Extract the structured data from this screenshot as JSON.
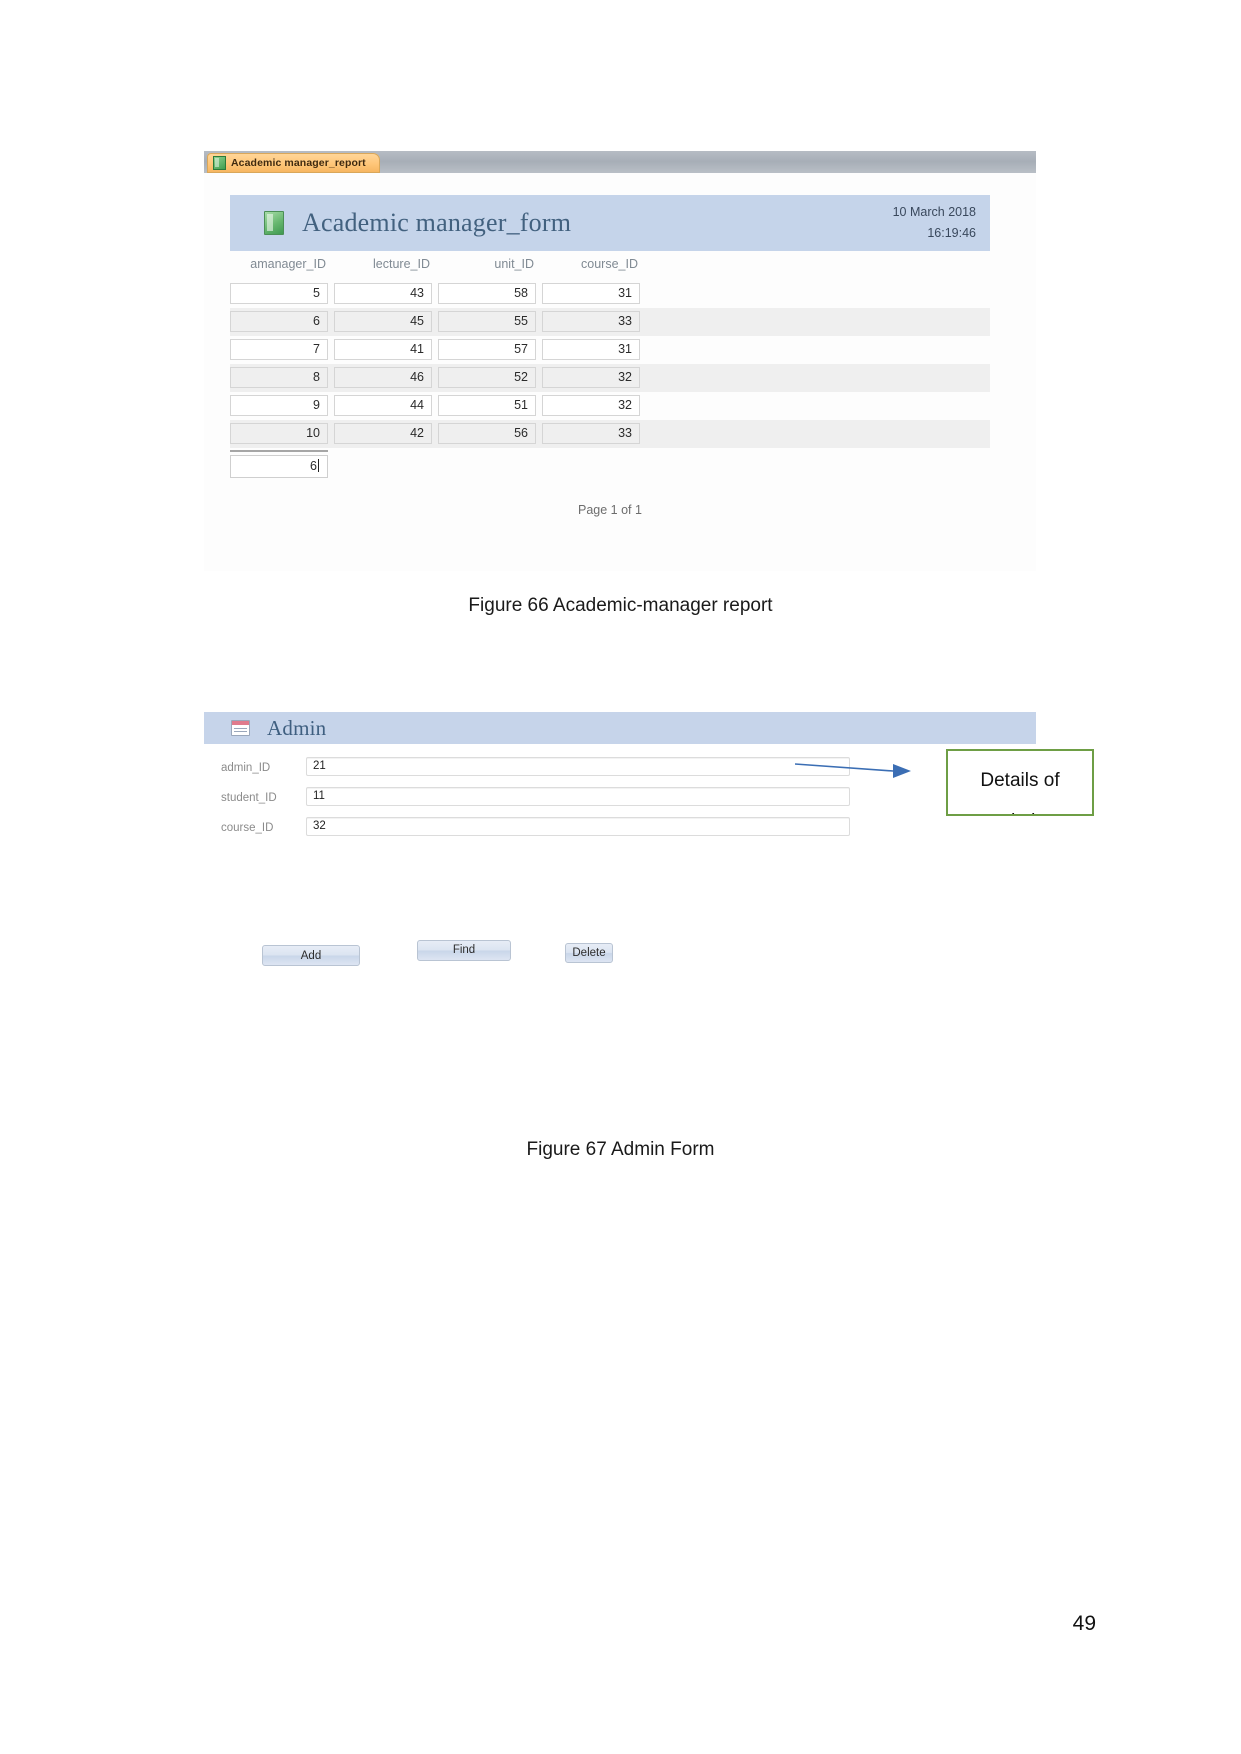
{
  "document": {
    "page_number": "49"
  },
  "figure66": {
    "caption": "Figure 66 Academic-manager report",
    "tab": {
      "label": "Academic manager_report",
      "icon": "report-icon"
    },
    "report": {
      "title": "Academic manager_form",
      "title_icon": "report-green-icon",
      "date": "10 March 2018",
      "time": "16:19:46",
      "columns": [
        "amanager_ID",
        "lecture_ID",
        "unit_ID",
        "course_ID"
      ],
      "rows": [
        [
          "5",
          "43",
          "58",
          "31"
        ],
        [
          "6",
          "45",
          "55",
          "33"
        ],
        [
          "7",
          "41",
          "57",
          "31"
        ],
        [
          "8",
          "46",
          "52",
          "32"
        ],
        [
          "9",
          "44",
          "51",
          "32"
        ],
        [
          "10",
          "42",
          "56",
          "33"
        ]
      ],
      "total_count": "6",
      "footer": "Page 1 of 1",
      "header_color": "#c5d4ea",
      "title_color": "#42617f"
    }
  },
  "figure67": {
    "caption": "Figure 67 Admin Form",
    "form": {
      "title": "Admin",
      "title_icon": "form-icon",
      "header_color": "#c6d4ea",
      "fields": [
        {
          "label": "admin_ID",
          "value": "21"
        },
        {
          "label": "student_ID",
          "value": "11"
        },
        {
          "label": "course_ID",
          "value": "32"
        }
      ],
      "buttons": [
        {
          "label": "Add"
        },
        {
          "label": "Find"
        },
        {
          "label": "Delete"
        }
      ]
    },
    "annotation": {
      "text": "Details of\nadmin",
      "border_color": "#6e9e45",
      "arrow_color": "#3b6eb4"
    }
  }
}
